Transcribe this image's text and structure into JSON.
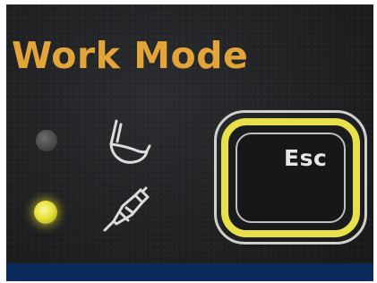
{
  "panel": {
    "title": "Work Mode",
    "esc_label": "Esc"
  },
  "indicators": [
    {
      "state": "off",
      "icon": "scaler-tip-icon"
    },
    {
      "state": "on",
      "icon": "handpiece-icon"
    }
  ],
  "colors": {
    "title": "#e3a53a",
    "panel": "#202224",
    "led_on": "#e8e23a",
    "led_off": "#55575a",
    "esc_ring": "#e8e04a",
    "bottom_strip": "#0a2a5c"
  }
}
